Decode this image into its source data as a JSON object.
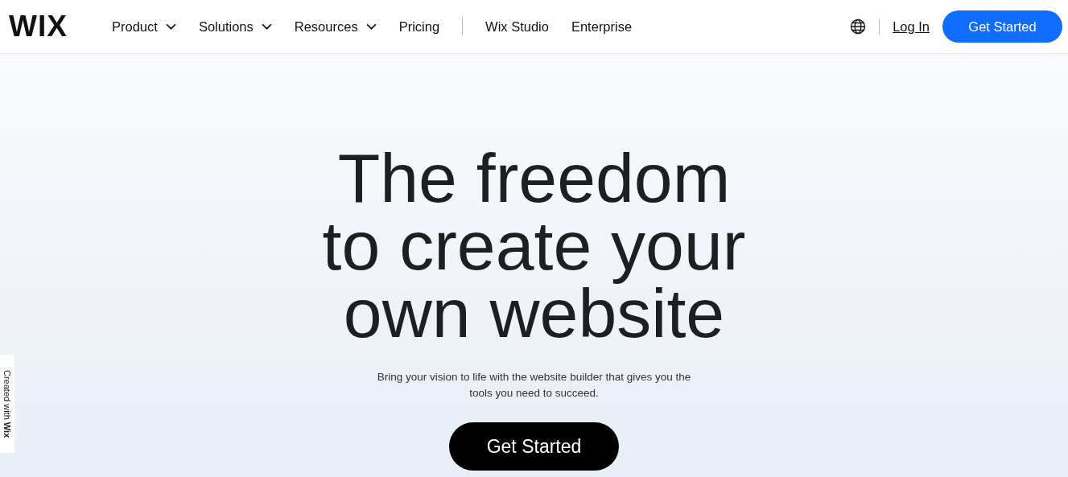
{
  "header": {
    "logo": "WIX",
    "nav_primary": [
      {
        "label": "Product",
        "has_menu": true
      },
      {
        "label": "Solutions",
        "has_menu": true
      },
      {
        "label": "Resources",
        "has_menu": true
      },
      {
        "label": "Pricing",
        "has_menu": false
      }
    ],
    "nav_secondary": [
      {
        "label": "Wix Studio",
        "has_menu": false
      },
      {
        "label": "Enterprise",
        "has_menu": false
      }
    ],
    "login": "Log In",
    "cta": "Get Started"
  },
  "hero": {
    "headline_lines": [
      "The freedom",
      "to create your",
      "own website"
    ],
    "subtitle": "Bring your vision to life with the website builder that gives you the tools you need to succeed.",
    "cta": "Get Started"
  },
  "side_badge": "Created with **Wix**"
}
